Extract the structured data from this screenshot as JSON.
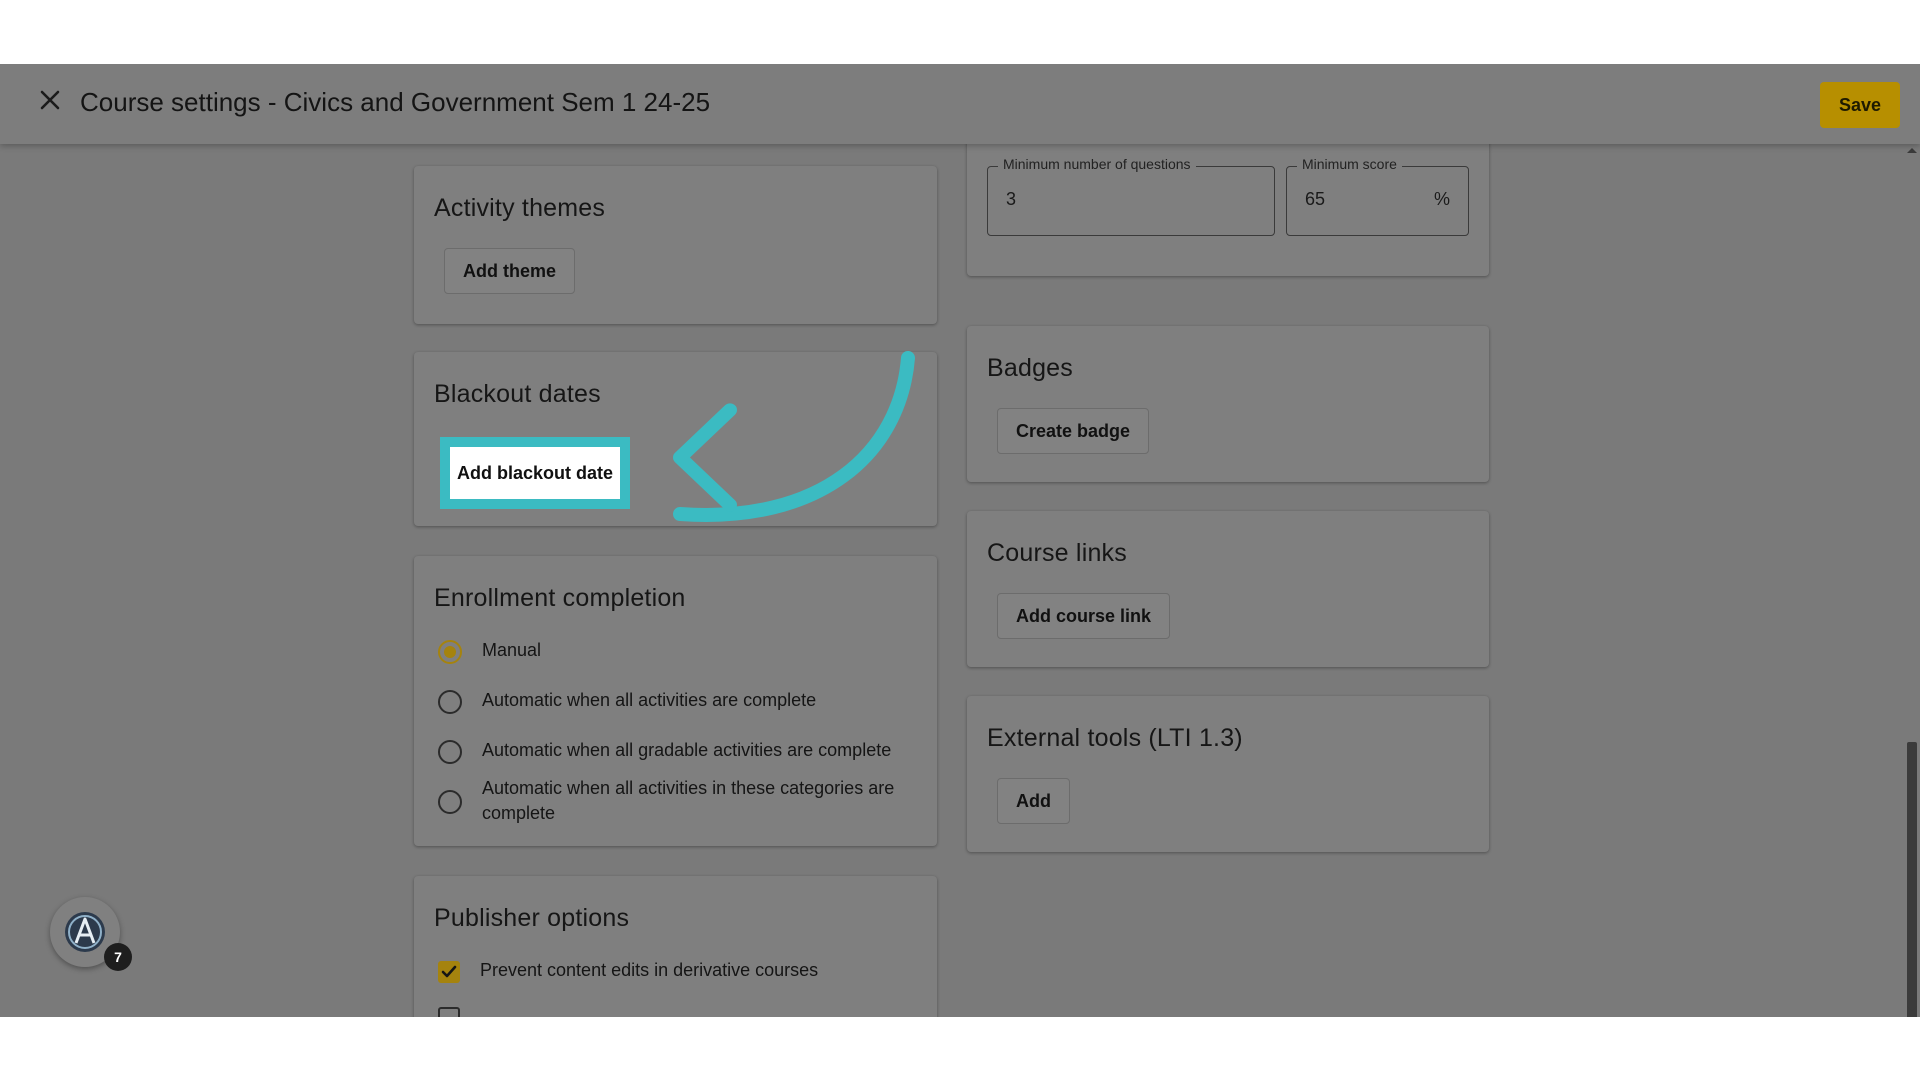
{
  "header": {
    "title": "Course settings - Civics and Government Sem 1 24-25",
    "save_label": "Save"
  },
  "left": {
    "activity_themes": {
      "title": "Activity themes",
      "button": "Add theme"
    },
    "blackout_dates": {
      "title": "Blackout dates",
      "button": "Add blackout date"
    },
    "enrollment_completion": {
      "title": "Enrollment completion",
      "options": [
        {
          "label": "Manual",
          "selected": true
        },
        {
          "label": "Automatic when all activities are complete",
          "selected": false
        },
        {
          "label": "Automatic when all gradable activities are complete",
          "selected": false
        },
        {
          "label": "Automatic when all activities in these categories are complete",
          "selected": false
        }
      ]
    },
    "publisher_options": {
      "title": "Publisher options",
      "checkboxes": [
        {
          "label": "Prevent content edits in derivative courses",
          "checked": true
        }
      ]
    }
  },
  "right": {
    "mastery": {
      "min_questions": {
        "label": "Minimum number of questions",
        "value": "3"
      },
      "min_score": {
        "label": "Minimum score",
        "value": "65",
        "suffix": "%"
      }
    },
    "badges": {
      "title": "Badges",
      "button": "Create badge"
    },
    "course_links": {
      "title": "Course links",
      "button": "Add course link"
    },
    "external_tools": {
      "title": "External tools (LTI 1.3)",
      "button": "Add"
    }
  },
  "assistant": {
    "badge_count": "7"
  },
  "colors": {
    "accent": "#b78f00",
    "highlight": "#3bbbc2",
    "overlay": "#7a7a7a"
  }
}
